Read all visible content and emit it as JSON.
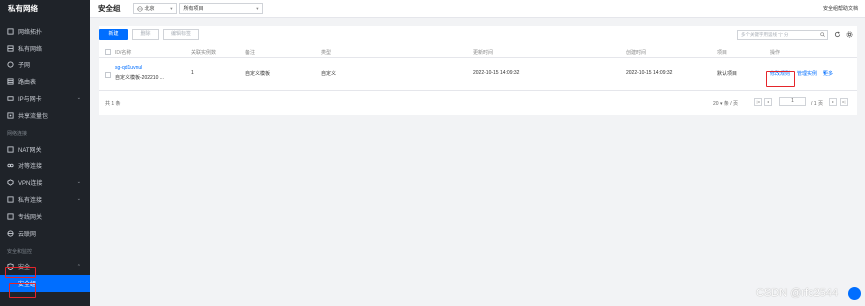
{
  "sidebar": {
    "title": "私有网络",
    "items": [
      {
        "label": "网络拓扑",
        "icon": "topology-icon"
      },
      {
        "label": "私有网络",
        "icon": "vpc-icon"
      },
      {
        "label": "子网",
        "icon": "subnet-icon"
      },
      {
        "label": "路由表",
        "icon": "route-table-icon"
      },
      {
        "label": "IP与网卡",
        "icon": "ip-nic-icon",
        "chevron": "⌄"
      },
      {
        "label": "共享流量包",
        "icon": "traffic-package-icon"
      }
    ],
    "section1": "网络连接",
    "items2": [
      {
        "label": "NAT网关",
        "icon": "nat-gateway-icon"
      },
      {
        "label": "对等连接",
        "icon": "peering-icon"
      },
      {
        "label": "VPN连接",
        "icon": "vpn-icon",
        "chevron": "⌄"
      },
      {
        "label": "私有连接",
        "icon": "private-link-icon",
        "chevron": "⌄"
      },
      {
        "label": "专线网关",
        "icon": "dc-gateway-icon"
      },
      {
        "label": "云联网",
        "icon": "ccn-icon"
      }
    ],
    "section2": "安全和监控",
    "security_label": "安全",
    "security_chevron": "⌃",
    "active_sub": "安全组"
  },
  "header": {
    "title": "安全组",
    "region": "北京",
    "project": "所有项目",
    "right_link": "安全组帮助文档"
  },
  "toolbar": {
    "new_label": "新建",
    "delete_label": "删除",
    "clone_label": "编辑标签",
    "search_placeholder": "多个关键字用竖线 \"|\" 分"
  },
  "table": {
    "headers": [
      "ID/名称",
      "关联实例数",
      "备注",
      "类型",
      "更新时间",
      "创建时间",
      "项目",
      "操作"
    ],
    "rows": [
      {
        "id": "sg-qd1uvnul",
        "name": "自定义模板-202210 ...",
        "instances": "1",
        "remark": "自定义模板",
        "type": "自定义",
        "updated": "2022-10-15 14:09:32",
        "created": "2022-10-15 14:09:32",
        "project": "默认项目",
        "action_modify": "修改规则",
        "action_manage": "管理实例",
        "action_more": "更多"
      }
    ]
  },
  "footer": {
    "total": "共 1 条",
    "page_size": "20 ▾ 条 / 页",
    "page": "1",
    "pages": "/ 1 页"
  },
  "watermark": "CSDN @rfc2544"
}
